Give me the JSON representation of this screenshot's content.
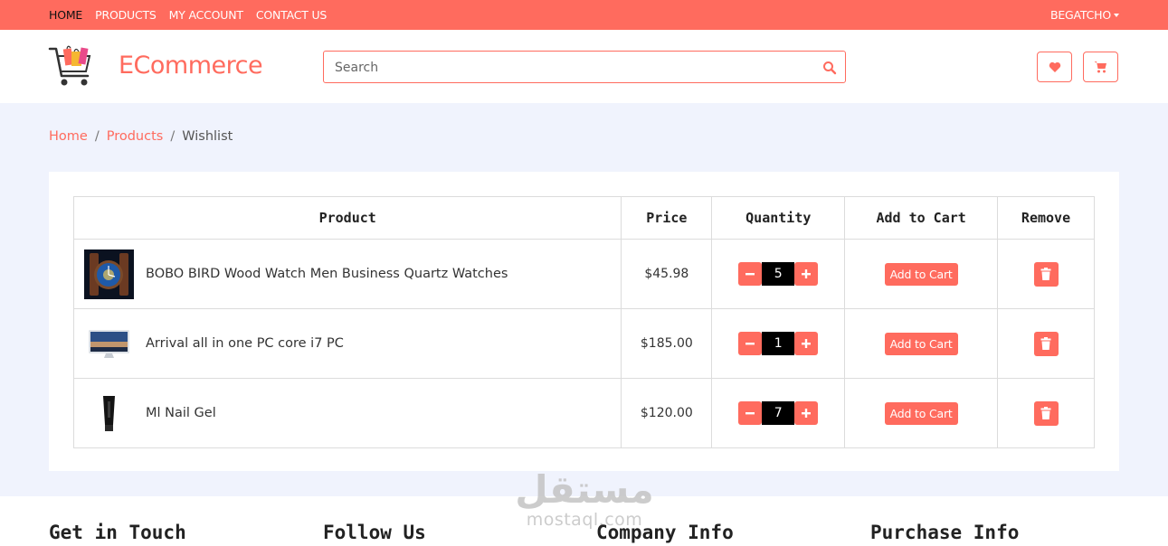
{
  "topnav": {
    "items": [
      "HOME",
      "PRODUCTS",
      "MY ACCOUNT",
      "CONTACT US"
    ],
    "user": "BEGATCHO"
  },
  "header": {
    "brand": "ECommerce",
    "search_placeholder": "Search"
  },
  "breadcrumb": [
    "Home",
    "Products",
    "Wishlist"
  ],
  "table": {
    "headers": [
      "Product",
      "Price",
      "Quantity",
      "Add to Cart",
      "Remove"
    ],
    "rows": [
      {
        "name": "BOBO BIRD Wood Watch Men Business Quartz Watches",
        "price": "$45.98",
        "qty": "5",
        "add_label": "Add to Cart"
      },
      {
        "name": "Arrival all in one PC core i7 PC",
        "price": "$185.00",
        "qty": "1",
        "add_label": "Add to Cart"
      },
      {
        "name": "Ml Nail Gel",
        "price": "$120.00",
        "qty": "7",
        "add_label": "Add to Cart"
      }
    ]
  },
  "footer": {
    "headings": [
      "Get in Touch",
      "Follow Us",
      "Company Info",
      "Purchase Info"
    ]
  },
  "watermark": {
    "arabic": "مستقل",
    "latin": "mostaql.com"
  },
  "colors": {
    "accent": "#ff6b5e",
    "page_bg": "#f0f3fd"
  },
  "icons": [
    "cart-logo-icon",
    "search-icon",
    "heart-icon",
    "cart-icon",
    "minus-icon",
    "plus-icon",
    "trash-icon"
  ]
}
